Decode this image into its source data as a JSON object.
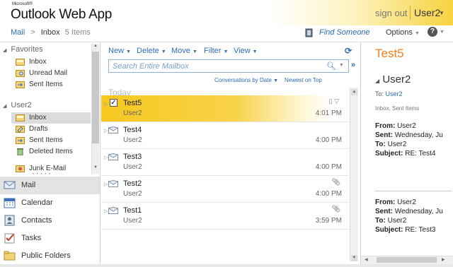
{
  "header": {
    "brand_small": "Microsoft®",
    "brand": "Outlook Web App",
    "sign_out": "sign out",
    "user": "User2"
  },
  "breadcrumb": {
    "mail": "Mail",
    "separator": ">",
    "folder": "Inbox",
    "count": "5 Items"
  },
  "top_actions": {
    "find_someone": "Find Someone",
    "options": "Options",
    "help": "?"
  },
  "nav": {
    "favorites_title": "Favorites",
    "favorites": [
      {
        "label": "Inbox",
        "icon": "inbox-icon"
      },
      {
        "label": "Unread Mail",
        "icon": "search-folder-icon"
      },
      {
        "label": "Sent Items",
        "icon": "sent-items-icon"
      }
    ],
    "mailbox_title": "User2",
    "folders": [
      {
        "label": "Inbox",
        "icon": "inbox-icon",
        "selected": true
      },
      {
        "label": "Drafts",
        "icon": "drafts-icon"
      },
      {
        "label": "Sent Items",
        "icon": "sent-items-icon"
      },
      {
        "label": "Deleted Items",
        "icon": "deleted-items-icon"
      },
      {
        "label": "Junk E-Mail",
        "icon": "junk-icon"
      }
    ],
    "modules": [
      {
        "label": "Mail",
        "icon": "mail-icon",
        "selected": true
      },
      {
        "label": "Calendar",
        "icon": "calendar-icon"
      },
      {
        "label": "Contacts",
        "icon": "contacts-icon"
      },
      {
        "label": "Tasks",
        "icon": "tasks-icon"
      },
      {
        "label": "Public Folders",
        "icon": "public-folders-icon"
      }
    ]
  },
  "toolbar": {
    "new": "New",
    "delete": "Delete",
    "move": "Move",
    "filter": "Filter",
    "view": "View"
  },
  "search": {
    "placeholder": "Search Entire Mailbox"
  },
  "sort": {
    "arrange_by": "Conversations by Date",
    "order": "Newest on Top"
  },
  "list": {
    "group_header": "Today",
    "messages": [
      {
        "subject": "Test5",
        "from": "User2",
        "time": "4:01 PM",
        "selected": true
      },
      {
        "subject": "Test4",
        "from": "User2",
        "time": "4:00 PM"
      },
      {
        "subject": "Test3",
        "from": "User2",
        "time": "4:00 PM"
      },
      {
        "subject": "Test2",
        "from": "User2",
        "time": "4:00 PM",
        "attachment": true
      },
      {
        "subject": "Test1",
        "from": "User2",
        "time": "3:59 PM",
        "attachment": true
      }
    ]
  },
  "reading_pane": {
    "title": "Test5",
    "sender": "User2",
    "to_label": "To:",
    "to_value": "User2",
    "folder_line": "Inbox, Sent Items",
    "blocks": [
      {
        "from_label": "From:",
        "from": "User2",
        "sent_label": "Sent:",
        "sent": "Wednesday, Ju",
        "to_label": "To:",
        "to": "User2",
        "subject_label": "Subject:",
        "subject": "RE: Test4"
      },
      {
        "from_label": "From:",
        "from": "User2",
        "sent_label": "Sent:",
        "sent": "Wednesday, Ju",
        "to_label": "To:",
        "to": "User2",
        "subject_label": "Subject:",
        "subject": "RE: Test3"
      }
    ]
  },
  "colors": {
    "accent_blue": "#2e6bb8",
    "selection_yellow": "#f6c81f",
    "title_orange": "#f07f1a"
  }
}
